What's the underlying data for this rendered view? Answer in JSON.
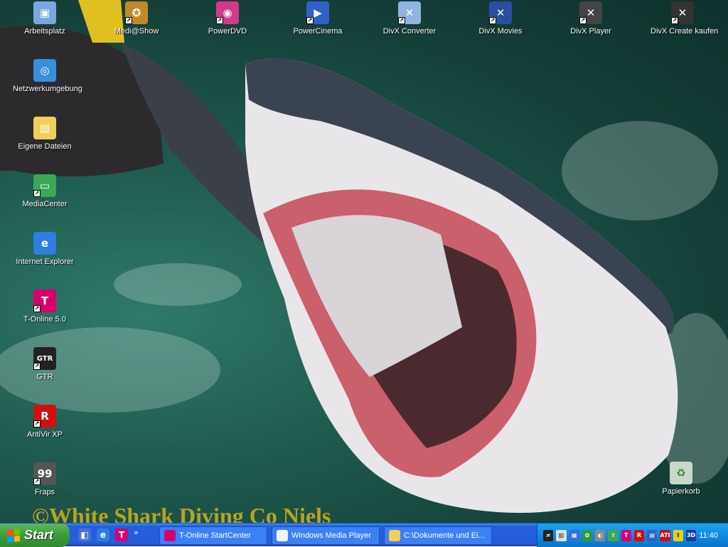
{
  "desktop": {
    "watermark": "©White Shark Diving Co Niels",
    "left_icons": [
      {
        "label": "Arbeitsplatz",
        "icon": "my-computer-icon",
        "color": "#7aa7e0",
        "glyph": "▣",
        "shortcut": false
      },
      {
        "label": "Netzwerkumgebung",
        "icon": "network-places-icon",
        "color": "#3a8fd9",
        "glyph": "◎",
        "shortcut": false
      },
      {
        "label": "Eigene Dateien",
        "icon": "my-documents-folder-icon",
        "color": "#f1cf5a",
        "glyph": "▤",
        "shortcut": false
      },
      {
        "label": "MediaCenter",
        "icon": "media-center-icon",
        "color": "#3aa855",
        "glyph": "▭",
        "shortcut": true
      },
      {
        "label": "Internet Explorer",
        "icon": "internet-explorer-icon",
        "color": "#2f7de0",
        "glyph": "e",
        "shortcut": false
      },
      {
        "label": "T-Online 5.0",
        "icon": "t-online-icon",
        "color": "#d6006f",
        "glyph": "T",
        "shortcut": true
      },
      {
        "label": "GTR",
        "icon": "gtr-game-icon",
        "color": "#222222",
        "glyph": "GTR",
        "shortcut": true
      },
      {
        "label": "AntiVir XP",
        "icon": "antivir-icon",
        "color": "#d01010",
        "glyph": "R",
        "shortcut": true
      },
      {
        "label": "Fraps",
        "icon": "fraps-icon",
        "color": "#555555",
        "glyph": "99",
        "shortcut": true
      }
    ],
    "top_icons": [
      {
        "label": "Medi@Show",
        "icon": "mediashow-icon",
        "color": "#c08a2a",
        "glyph": "✪",
        "shortcut": true
      },
      {
        "label": "PowerDVD",
        "icon": "powerdvd-icon",
        "color": "#d23a8a",
        "glyph": "◉",
        "shortcut": true
      },
      {
        "label": "PowerCinema",
        "icon": "powercinema-icon",
        "color": "#3160c8",
        "glyph": "▶",
        "shortcut": true
      },
      {
        "label": "DivX Converter",
        "icon": "divx-converter-icon",
        "color": "#8fb6e3",
        "glyph": "✕",
        "shortcut": true
      },
      {
        "label": "DivX Movies",
        "icon": "divx-movies-icon",
        "color": "#2b4f9c",
        "glyph": "✕",
        "shortcut": true
      },
      {
        "label": "DivX Player",
        "icon": "divx-player-icon",
        "color": "#444444",
        "glyph": "✕",
        "shortcut": true
      },
      {
        "label": "DivX Create kaufen",
        "icon": "divx-create-icon",
        "color": "#333333",
        "glyph": "✕",
        "shortcut": true
      }
    ],
    "recycle_bin": {
      "label": "Papierkorb",
      "icon": "recycle-bin-icon",
      "color": "#c9d9c9",
      "glyph": "♻"
    }
  },
  "taskbar": {
    "start_label": "Start",
    "quick_launch": [
      {
        "icon": "show-desktop-icon",
        "color": "#4a6fd0",
        "glyph": "◧"
      },
      {
        "icon": "internet-explorer-icon",
        "color": "#2f7de0",
        "glyph": "e"
      },
      {
        "icon": "t-online-icon",
        "color": "#d6006f",
        "glyph": "T"
      }
    ],
    "quick_more": "»",
    "tasks": [
      {
        "label": "T-Online StartCenter",
        "icon": "t-online-icon",
        "color": "#d6006f"
      },
      {
        "label": "Windows Media Player",
        "icon": "media-player-icon",
        "color": "#f3f3f3"
      },
      {
        "label": "C:\\Dokumente und Ei...",
        "icon": "folder-icon",
        "color": "#f1cf5a"
      }
    ],
    "tray": [
      {
        "icon": "runner-icon",
        "color": "#222",
        "glyph": "≠"
      },
      {
        "icon": "printer-icon",
        "color": "#ddd",
        "glyph": "▥"
      },
      {
        "icon": "network-icon",
        "color": "#3a6fd0",
        "glyph": "▦"
      },
      {
        "icon": "messenger-icon",
        "color": "#2e9a3e",
        "glyph": "✿"
      },
      {
        "icon": "volume-icon",
        "color": "#888",
        "glyph": "◐"
      },
      {
        "icon": "usb-icon",
        "color": "#3aa855",
        "glyph": "⇪"
      },
      {
        "icon": "t-online-icon",
        "color": "#d6006f",
        "glyph": "T"
      },
      {
        "icon": "antivir-icon",
        "color": "#d01010",
        "glyph": "R"
      },
      {
        "icon": "media-icon",
        "color": "#3160c8",
        "glyph": "▤"
      },
      {
        "icon": "ati-icon",
        "color": "#c81414",
        "glyph": "ATI"
      },
      {
        "icon": "update-icon",
        "color": "#e8d018",
        "glyph": "⇕"
      },
      {
        "icon": "xpert-3d-icon",
        "color": "#1a3a9a",
        "glyph": "3D"
      }
    ],
    "clock": "11:40"
  }
}
